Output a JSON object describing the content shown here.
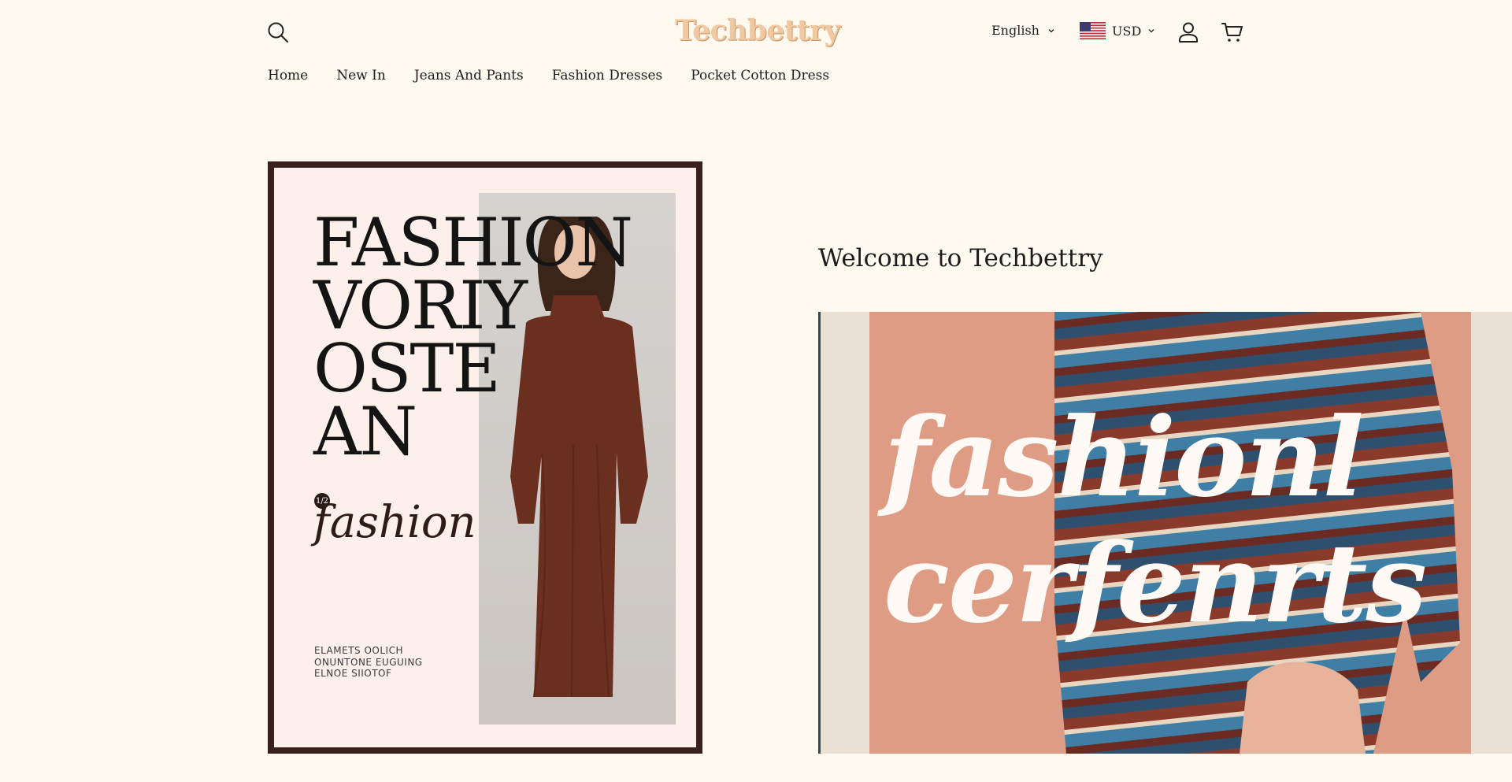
{
  "header": {
    "logo_text": "Techbettry",
    "language_label": "English",
    "currency_label": "USD",
    "icons": {
      "search": "search-icon",
      "account": "user-icon",
      "cart": "cart-icon",
      "flag": "us-flag-icon"
    }
  },
  "nav": {
    "items": [
      {
        "label": "Home"
      },
      {
        "label": "New In"
      },
      {
        "label": "Jeans And Pants"
      },
      {
        "label": "Fashion Dresses"
      },
      {
        "label": "Pocket Cotton Dress"
      }
    ]
  },
  "poster": {
    "title_lines": [
      "FASHION",
      "VORIY",
      "OSTE",
      "AN"
    ],
    "badge": "1/2",
    "script_text": "fashion",
    "small_lines": [
      "ELAMETS OOLICH",
      "ONUNTONE EUGUING",
      "ELNOE SIIOTOF"
    ]
  },
  "main": {
    "welcome_title": "Welcome to Techbettry",
    "banner_lines": [
      "fashionl",
      "cerfenrts"
    ]
  },
  "colors": {
    "background": "#fffaef",
    "text": "#1d1d1d",
    "logo": "#f0c9a2",
    "poster_frame": "#3a211b",
    "banner_bg": "#de9c84"
  }
}
